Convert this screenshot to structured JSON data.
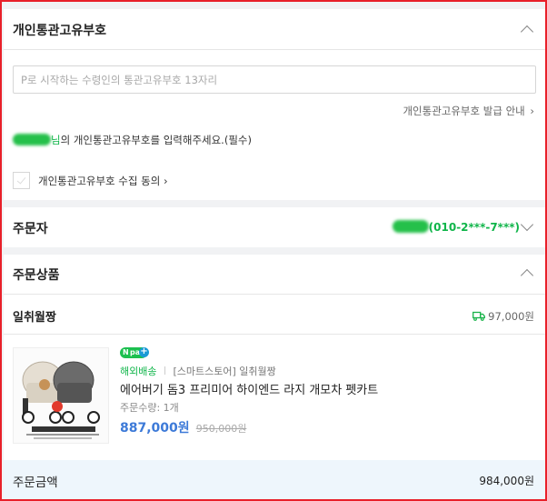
{
  "customs": {
    "title": "개인통관고유부호",
    "input_placeholder": "P로 시작하는 수령인의 통관고유부호 13자리",
    "guide_link": "개인통관고유부호 발급 안내",
    "notice_suffix": "님",
    "notice_text": "의 개인통관고유부호를 입력해주세요.(필수)",
    "consent_label": "개인통관고유부호 수집 동의"
  },
  "orderer": {
    "title": "주문자",
    "phone": "(010-2***-7***)"
  },
  "products": {
    "title": "주문상품",
    "store_name": "일취월짱",
    "shipping_fee": "97,000원",
    "item": {
      "npay_badge": "pay",
      "tag_overseas": "해외배송",
      "tag_store": "[스마트스토어] 일취월짱",
      "name": "에어버기 돔3 프리미어 하이엔드 라지 개모차 펫카트",
      "quantity": "주문수량: 1개",
      "price": "887,000원",
      "original_price": "950,000원"
    }
  },
  "summary": {
    "label": "주문금액",
    "amount": "984,000원"
  },
  "colors": {
    "accent_green": "#10b54a",
    "price_blue": "#3d7ad8",
    "frame_red": "#e8202a"
  }
}
